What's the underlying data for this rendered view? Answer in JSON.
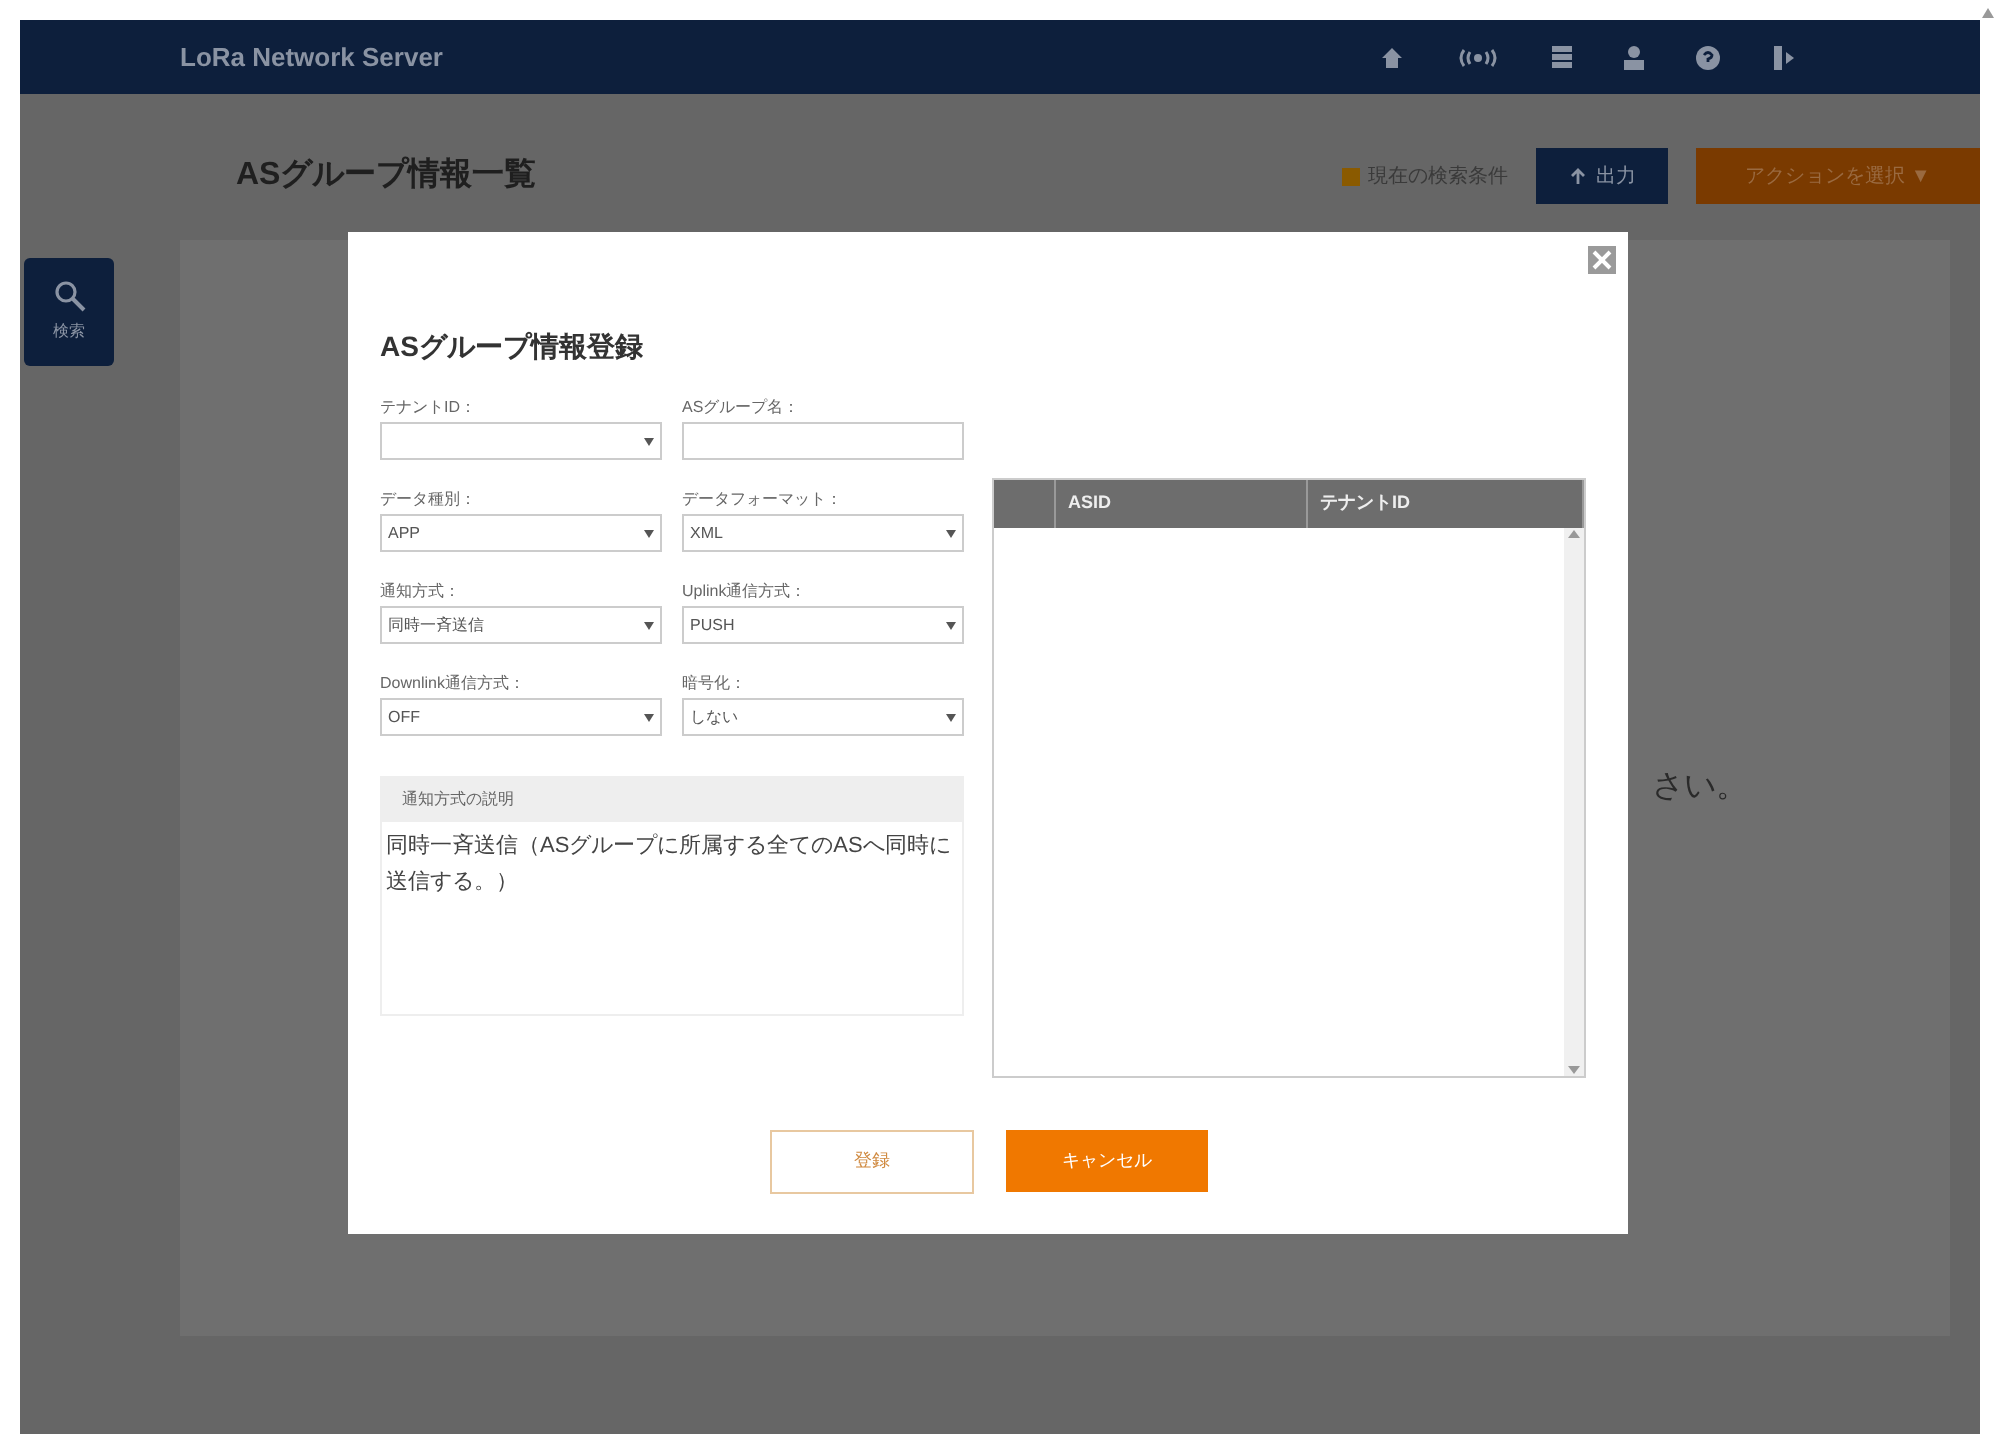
{
  "header": {
    "title": "LoRa Network Server"
  },
  "page": {
    "title": "ASグループ情報一覧",
    "search_conditions": "現在の検索条件",
    "export_button": "出力",
    "action_button": "アクションを選択 ▼",
    "side_search": "検索",
    "background_text": "さい。"
  },
  "dialog": {
    "title": "ASグループ情報登録",
    "fields": [
      {
        "label": "テナントID：",
        "kind": "select"
      },
      {
        "label": "ASグループ名：",
        "kind": "text"
      },
      {
        "label": "データ種別：",
        "kind": "select",
        "value": "APP"
      },
      {
        "label": "データフォーマット：",
        "kind": "select",
        "value": "XML"
      },
      {
        "label": "通知方式：",
        "kind": "select",
        "value": "同時一斉送信"
      },
      {
        "label": "Uplink通信方式：",
        "kind": "select",
        "value": "PUSH"
      },
      {
        "label": "Downlink通信方式：",
        "kind": "select",
        "value": "OFF"
      },
      {
        "label": "暗号化：",
        "kind": "select",
        "value": "しない"
      }
    ],
    "description": {
      "heading": "通知方式の説明",
      "text": "同時一斉送信（ASグループに所属する全てのASへ同時に送信する。）"
    },
    "table": {
      "columns": [
        "ASID",
        "テナントID"
      ]
    },
    "buttons": [
      {
        "label": "登録",
        "kind": "secondary"
      },
      {
        "label": "キャンセル",
        "kind": "primary"
      }
    ]
  }
}
